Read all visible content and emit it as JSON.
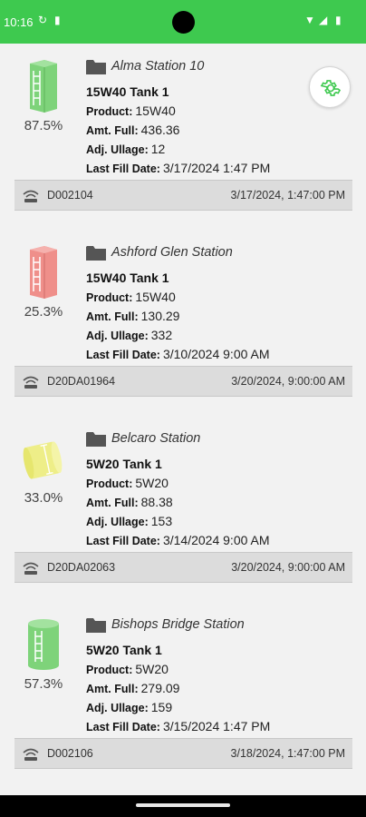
{
  "status_bar": {
    "time": "10:16",
    "icons": [
      "sync-icon",
      "sd-card-icon",
      "wifi-icon",
      "signal-icon",
      "battery-icon"
    ]
  },
  "colors": {
    "status_bar": "#3ec94f",
    "tank_green": "#7ed37a",
    "tank_red": "#ef8f8a",
    "tank_yellow": "#eeee88",
    "gear_icon": "#3ec94f"
  },
  "tanks": [
    {
      "station": "Alma Station 10",
      "tank_name": "15W40 Tank 1",
      "product_label": "Product:",
      "product": "15W40",
      "amt_label": "Amt. Full:",
      "amt_full": "436.36",
      "ullage_label": "Adj. Ullage:",
      "ullage": "12",
      "fill_label": "Last Fill Date:",
      "last_fill": "3/17/2024 1:47 PM",
      "percent": "87.5%",
      "fill_level": 0.875,
      "tank_icon": "vertical-tank-green-icon",
      "device_id": "D002104",
      "reading_time": "3/17/2024, 1:47:00 PM"
    },
    {
      "station": "Ashford Glen Station",
      "tank_name": "15W40 Tank 1",
      "product_label": "Product:",
      "product": "15W40",
      "amt_label": "Amt. Full:",
      "amt_full": "130.29",
      "ullage_label": "Adj. Ullage:",
      "ullage": "332",
      "fill_label": "Last Fill Date:",
      "last_fill": "3/10/2024 9:00 AM",
      "percent": "25.3%",
      "fill_level": 0.253,
      "tank_icon": "vertical-tank-red-icon",
      "device_id": "D20DA01964",
      "reading_time": "3/20/2024, 9:00:00 AM"
    },
    {
      "station": "Belcaro Station",
      "tank_name": "5W20 Tank 1",
      "product_label": "Product:",
      "product": "5W20",
      "amt_label": "Amt. Full:",
      "amt_full": "88.38",
      "ullage_label": "Adj. Ullage:",
      "ullage": "153",
      "fill_label": "Last Fill Date:",
      "last_fill": "3/14/2024 9:00 AM",
      "percent": "33.0%",
      "fill_level": 0.33,
      "tank_icon": "horizontal-tank-yellow-icon",
      "device_id": "D20DA02063",
      "reading_time": "3/20/2024, 9:00:00 AM"
    },
    {
      "station": "Bishops Bridge Station",
      "tank_name": "5W20 Tank 1",
      "product_label": "Product:",
      "product": "5W20",
      "amt_label": "Amt. Full:",
      "amt_full": "279.09",
      "ullage_label": "Adj. Ullage:",
      "ullage": "159",
      "fill_label": "Last Fill Date:",
      "last_fill": "3/15/2024 1:47 PM",
      "percent": "57.3%",
      "fill_level": 0.573,
      "tank_icon": "cylinder-tank-green-icon",
      "device_id": "D002106",
      "reading_time": "3/18/2024, 1:47:00 PM"
    }
  ]
}
